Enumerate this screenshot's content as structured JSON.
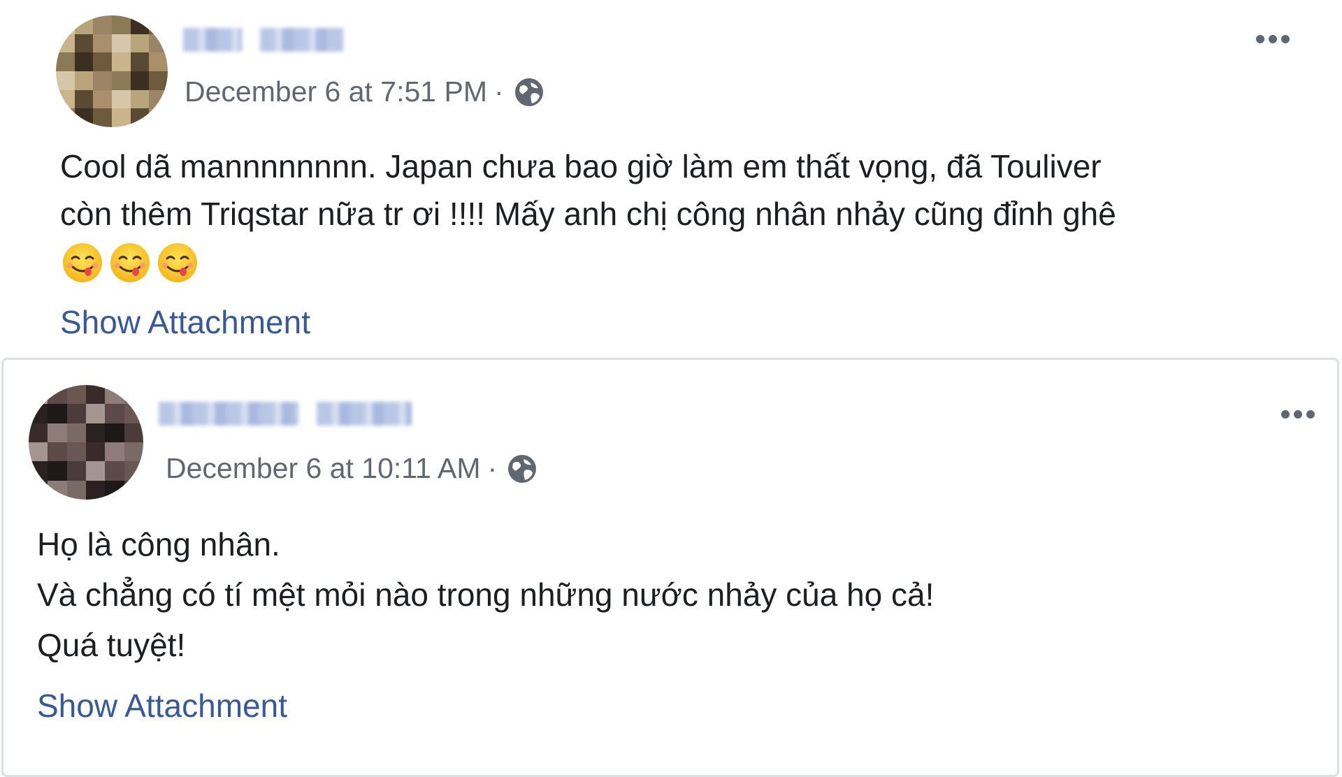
{
  "posts": [
    {
      "timestamp": "December 6 at 7:51 PM",
      "separator": "·",
      "privacy_icon": "globe-icon",
      "text_lines": [
        "Cool dã mannnnnnnn. Japan chưa bao giờ làm em thất vọng, đã Touliver",
        "còn thêm Triqstar nữa tr ơi !!!! Mấy anh chị công nhân nhảy cũng đỉnh ghê"
      ],
      "emoji": [
        "😋",
        "😋",
        "😋"
      ],
      "attachment_label": "Show Attachment",
      "more_icon": "more-options-icon"
    },
    {
      "timestamp": "December 6 at 10:11 AM",
      "separator": "·",
      "privacy_icon": "globe-icon",
      "text_lines": [
        "Họ là công nhân.",
        "Và chẳng có tí mệt mỏi nào trong những nước nhảy của họ cả!",
        "Quá tuyệt!"
      ],
      "attachment_label": "Show Attachment",
      "more_icon": "more-options-icon"
    }
  ],
  "colors": {
    "link": "#385898",
    "meta": "#616770",
    "text": "#1c1e21",
    "border": "#dddfe2"
  }
}
